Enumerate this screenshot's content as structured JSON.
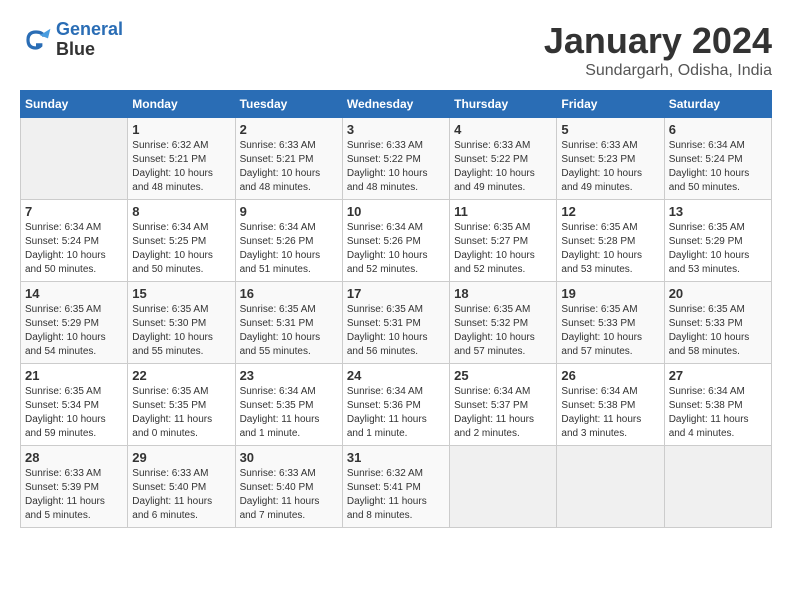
{
  "header": {
    "logo_line1": "General",
    "logo_line2": "Blue",
    "title": "January 2024",
    "subtitle": "Sundargarh, Odisha, India"
  },
  "weekdays": [
    "Sunday",
    "Monday",
    "Tuesday",
    "Wednesday",
    "Thursday",
    "Friday",
    "Saturday"
  ],
  "weeks": [
    [
      {
        "day": "",
        "info": ""
      },
      {
        "day": "1",
        "info": "Sunrise: 6:32 AM\nSunset: 5:21 PM\nDaylight: 10 hours\nand 48 minutes."
      },
      {
        "day": "2",
        "info": "Sunrise: 6:33 AM\nSunset: 5:21 PM\nDaylight: 10 hours\nand 48 minutes."
      },
      {
        "day": "3",
        "info": "Sunrise: 6:33 AM\nSunset: 5:22 PM\nDaylight: 10 hours\nand 48 minutes."
      },
      {
        "day": "4",
        "info": "Sunrise: 6:33 AM\nSunset: 5:22 PM\nDaylight: 10 hours\nand 49 minutes."
      },
      {
        "day": "5",
        "info": "Sunrise: 6:33 AM\nSunset: 5:23 PM\nDaylight: 10 hours\nand 49 minutes."
      },
      {
        "day": "6",
        "info": "Sunrise: 6:34 AM\nSunset: 5:24 PM\nDaylight: 10 hours\nand 50 minutes."
      }
    ],
    [
      {
        "day": "7",
        "info": "Sunrise: 6:34 AM\nSunset: 5:24 PM\nDaylight: 10 hours\nand 50 minutes."
      },
      {
        "day": "8",
        "info": "Sunrise: 6:34 AM\nSunset: 5:25 PM\nDaylight: 10 hours\nand 50 minutes."
      },
      {
        "day": "9",
        "info": "Sunrise: 6:34 AM\nSunset: 5:26 PM\nDaylight: 10 hours\nand 51 minutes."
      },
      {
        "day": "10",
        "info": "Sunrise: 6:34 AM\nSunset: 5:26 PM\nDaylight: 10 hours\nand 52 minutes."
      },
      {
        "day": "11",
        "info": "Sunrise: 6:35 AM\nSunset: 5:27 PM\nDaylight: 10 hours\nand 52 minutes."
      },
      {
        "day": "12",
        "info": "Sunrise: 6:35 AM\nSunset: 5:28 PM\nDaylight: 10 hours\nand 53 minutes."
      },
      {
        "day": "13",
        "info": "Sunrise: 6:35 AM\nSunset: 5:29 PM\nDaylight: 10 hours\nand 53 minutes."
      }
    ],
    [
      {
        "day": "14",
        "info": "Sunrise: 6:35 AM\nSunset: 5:29 PM\nDaylight: 10 hours\nand 54 minutes."
      },
      {
        "day": "15",
        "info": "Sunrise: 6:35 AM\nSunset: 5:30 PM\nDaylight: 10 hours\nand 55 minutes."
      },
      {
        "day": "16",
        "info": "Sunrise: 6:35 AM\nSunset: 5:31 PM\nDaylight: 10 hours\nand 55 minutes."
      },
      {
        "day": "17",
        "info": "Sunrise: 6:35 AM\nSunset: 5:31 PM\nDaylight: 10 hours\nand 56 minutes."
      },
      {
        "day": "18",
        "info": "Sunrise: 6:35 AM\nSunset: 5:32 PM\nDaylight: 10 hours\nand 57 minutes."
      },
      {
        "day": "19",
        "info": "Sunrise: 6:35 AM\nSunset: 5:33 PM\nDaylight: 10 hours\nand 57 minutes."
      },
      {
        "day": "20",
        "info": "Sunrise: 6:35 AM\nSunset: 5:33 PM\nDaylight: 10 hours\nand 58 minutes."
      }
    ],
    [
      {
        "day": "21",
        "info": "Sunrise: 6:35 AM\nSunset: 5:34 PM\nDaylight: 10 hours\nand 59 minutes."
      },
      {
        "day": "22",
        "info": "Sunrise: 6:35 AM\nSunset: 5:35 PM\nDaylight: 11 hours\nand 0 minutes."
      },
      {
        "day": "23",
        "info": "Sunrise: 6:34 AM\nSunset: 5:35 PM\nDaylight: 11 hours\nand 1 minute."
      },
      {
        "day": "24",
        "info": "Sunrise: 6:34 AM\nSunset: 5:36 PM\nDaylight: 11 hours\nand 1 minute."
      },
      {
        "day": "25",
        "info": "Sunrise: 6:34 AM\nSunset: 5:37 PM\nDaylight: 11 hours\nand 2 minutes."
      },
      {
        "day": "26",
        "info": "Sunrise: 6:34 AM\nSunset: 5:38 PM\nDaylight: 11 hours\nand 3 minutes."
      },
      {
        "day": "27",
        "info": "Sunrise: 6:34 AM\nSunset: 5:38 PM\nDaylight: 11 hours\nand 4 minutes."
      }
    ],
    [
      {
        "day": "28",
        "info": "Sunrise: 6:33 AM\nSunset: 5:39 PM\nDaylight: 11 hours\nand 5 minutes."
      },
      {
        "day": "29",
        "info": "Sunrise: 6:33 AM\nSunset: 5:40 PM\nDaylight: 11 hours\nand 6 minutes."
      },
      {
        "day": "30",
        "info": "Sunrise: 6:33 AM\nSunset: 5:40 PM\nDaylight: 11 hours\nand 7 minutes."
      },
      {
        "day": "31",
        "info": "Sunrise: 6:32 AM\nSunset: 5:41 PM\nDaylight: 11 hours\nand 8 minutes."
      },
      {
        "day": "",
        "info": ""
      },
      {
        "day": "",
        "info": ""
      },
      {
        "day": "",
        "info": ""
      }
    ]
  ]
}
